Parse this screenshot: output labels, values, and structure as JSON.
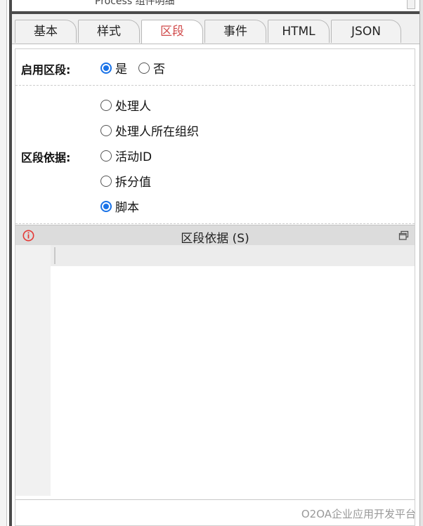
{
  "top_strip": {
    "clipped_text": "Process 组件明细"
  },
  "tabs": [
    {
      "label": "基本",
      "active": false
    },
    {
      "label": "样式",
      "active": false
    },
    {
      "label": "区段",
      "active": true
    },
    {
      "label": "事件",
      "active": false
    },
    {
      "label": "HTML",
      "active": false
    },
    {
      "label": "JSON",
      "active": false
    }
  ],
  "enable_section": {
    "label": "启用区段:",
    "options": [
      {
        "label": "是",
        "checked": true
      },
      {
        "label": "否",
        "checked": false
      }
    ]
  },
  "section_basis": {
    "label": "区段依据:",
    "options": [
      {
        "label": "处理人",
        "checked": false
      },
      {
        "label": "处理人所在组织",
        "checked": false
      },
      {
        "label": "活动ID",
        "checked": false
      },
      {
        "label": "拆分值",
        "checked": false
      },
      {
        "label": "脚本",
        "checked": true
      }
    ]
  },
  "script_editor": {
    "title": "区段依据 (S)",
    "info_icon": "info-circle-icon",
    "maximize_icon": "maximize-window-icon",
    "content": ""
  },
  "watermark": "O2OA企业应用开发平台",
  "colors": {
    "accent": "#1a73e8",
    "active_tab_text": "#d04a4a",
    "info_icon": "#e53935"
  }
}
